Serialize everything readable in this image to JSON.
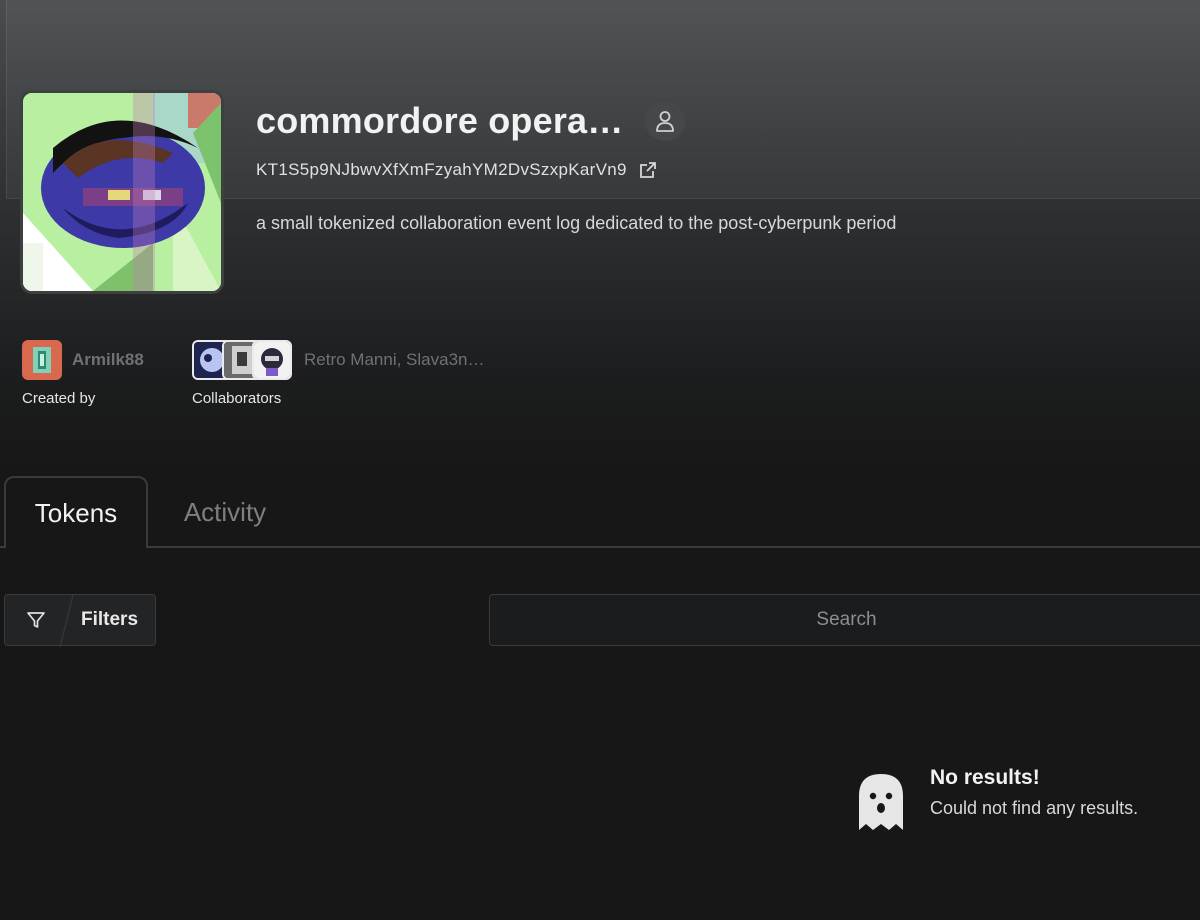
{
  "collection": {
    "title": "commordore opera…",
    "contract": "KT1S5p9NJbwvXfXmFzyahYM2DvSzxpKarVn9",
    "description": "a small tokenized collaboration event log dedicated to the post-cyberpunk period"
  },
  "creator": {
    "name": "Armilk88",
    "caption": "Created by"
  },
  "collaborators": {
    "names": "Retro Manni, Slava3n…",
    "caption": "Collaborators"
  },
  "tabs": [
    {
      "label": "Tokens",
      "active": true
    },
    {
      "label": "Activity",
      "active": false
    }
  ],
  "toolbar": {
    "filters_label": "Filters",
    "search_placeholder": "Search"
  },
  "empty_state": {
    "title": "No results!",
    "message": "Could not find any results."
  },
  "icons": {
    "profile": "user-icon",
    "contract_link": "external-link-icon",
    "filter": "funnel-icon",
    "empty": "ghost-icon"
  },
  "colors": {
    "background": "#171717",
    "creator_avatar": "#d8694f",
    "muted_text": "#6f7173"
  }
}
